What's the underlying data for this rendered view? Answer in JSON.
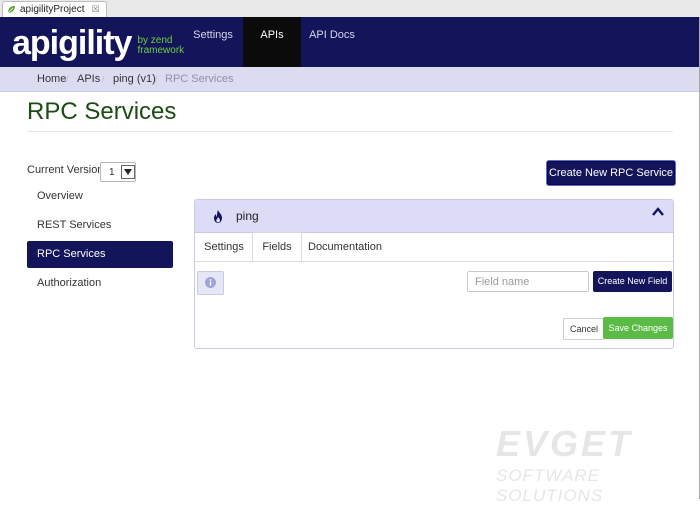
{
  "editor_tab": {
    "title": "apigilityProject",
    "close_glyph": "☒",
    "icon": "apigility-leaf-icon"
  },
  "navbar": {
    "logo": {
      "word": "apigility",
      "by_line": "by zend",
      "framework_line": "framework"
    },
    "items": [
      {
        "label": "Settings"
      },
      {
        "label": "APIs"
      },
      {
        "label": "API Docs"
      }
    ],
    "active_item": "APIs"
  },
  "breadcrumb": {
    "items": [
      {
        "label": "Home"
      },
      {
        "label": "APIs"
      },
      {
        "label": "ping (v1)"
      },
      {
        "label": "RPC Services"
      }
    ],
    "separator": "/"
  },
  "page": {
    "title": "RPC Services",
    "version_label": "Current Version:",
    "version_value": "1",
    "create_button": "Create New RPC Service"
  },
  "sidebar": {
    "items": [
      {
        "label": "Overview"
      },
      {
        "label": "REST Services"
      },
      {
        "label": "RPC Services"
      },
      {
        "label": "Authorization"
      }
    ],
    "active_item": "RPC Services"
  },
  "service_panel": {
    "name": "ping",
    "icon": "flame-icon",
    "tabs": [
      {
        "label": "Settings"
      },
      {
        "label": "Fields"
      },
      {
        "label": "Documentation"
      }
    ],
    "active_tab": "Fields",
    "field_name_placeholder": "Field name",
    "create_field_button": "Create New Field",
    "cancel_button": "Cancel",
    "save_button": "Save Changes"
  },
  "watermark": {
    "line1": "EVGET",
    "line2": "SOFTWARE SOLUTIONS"
  },
  "colors": {
    "navy": "#13145a",
    "green_save": "#5cba47",
    "title_green": "#1b4d12",
    "lavender": "#dcdcf7"
  }
}
